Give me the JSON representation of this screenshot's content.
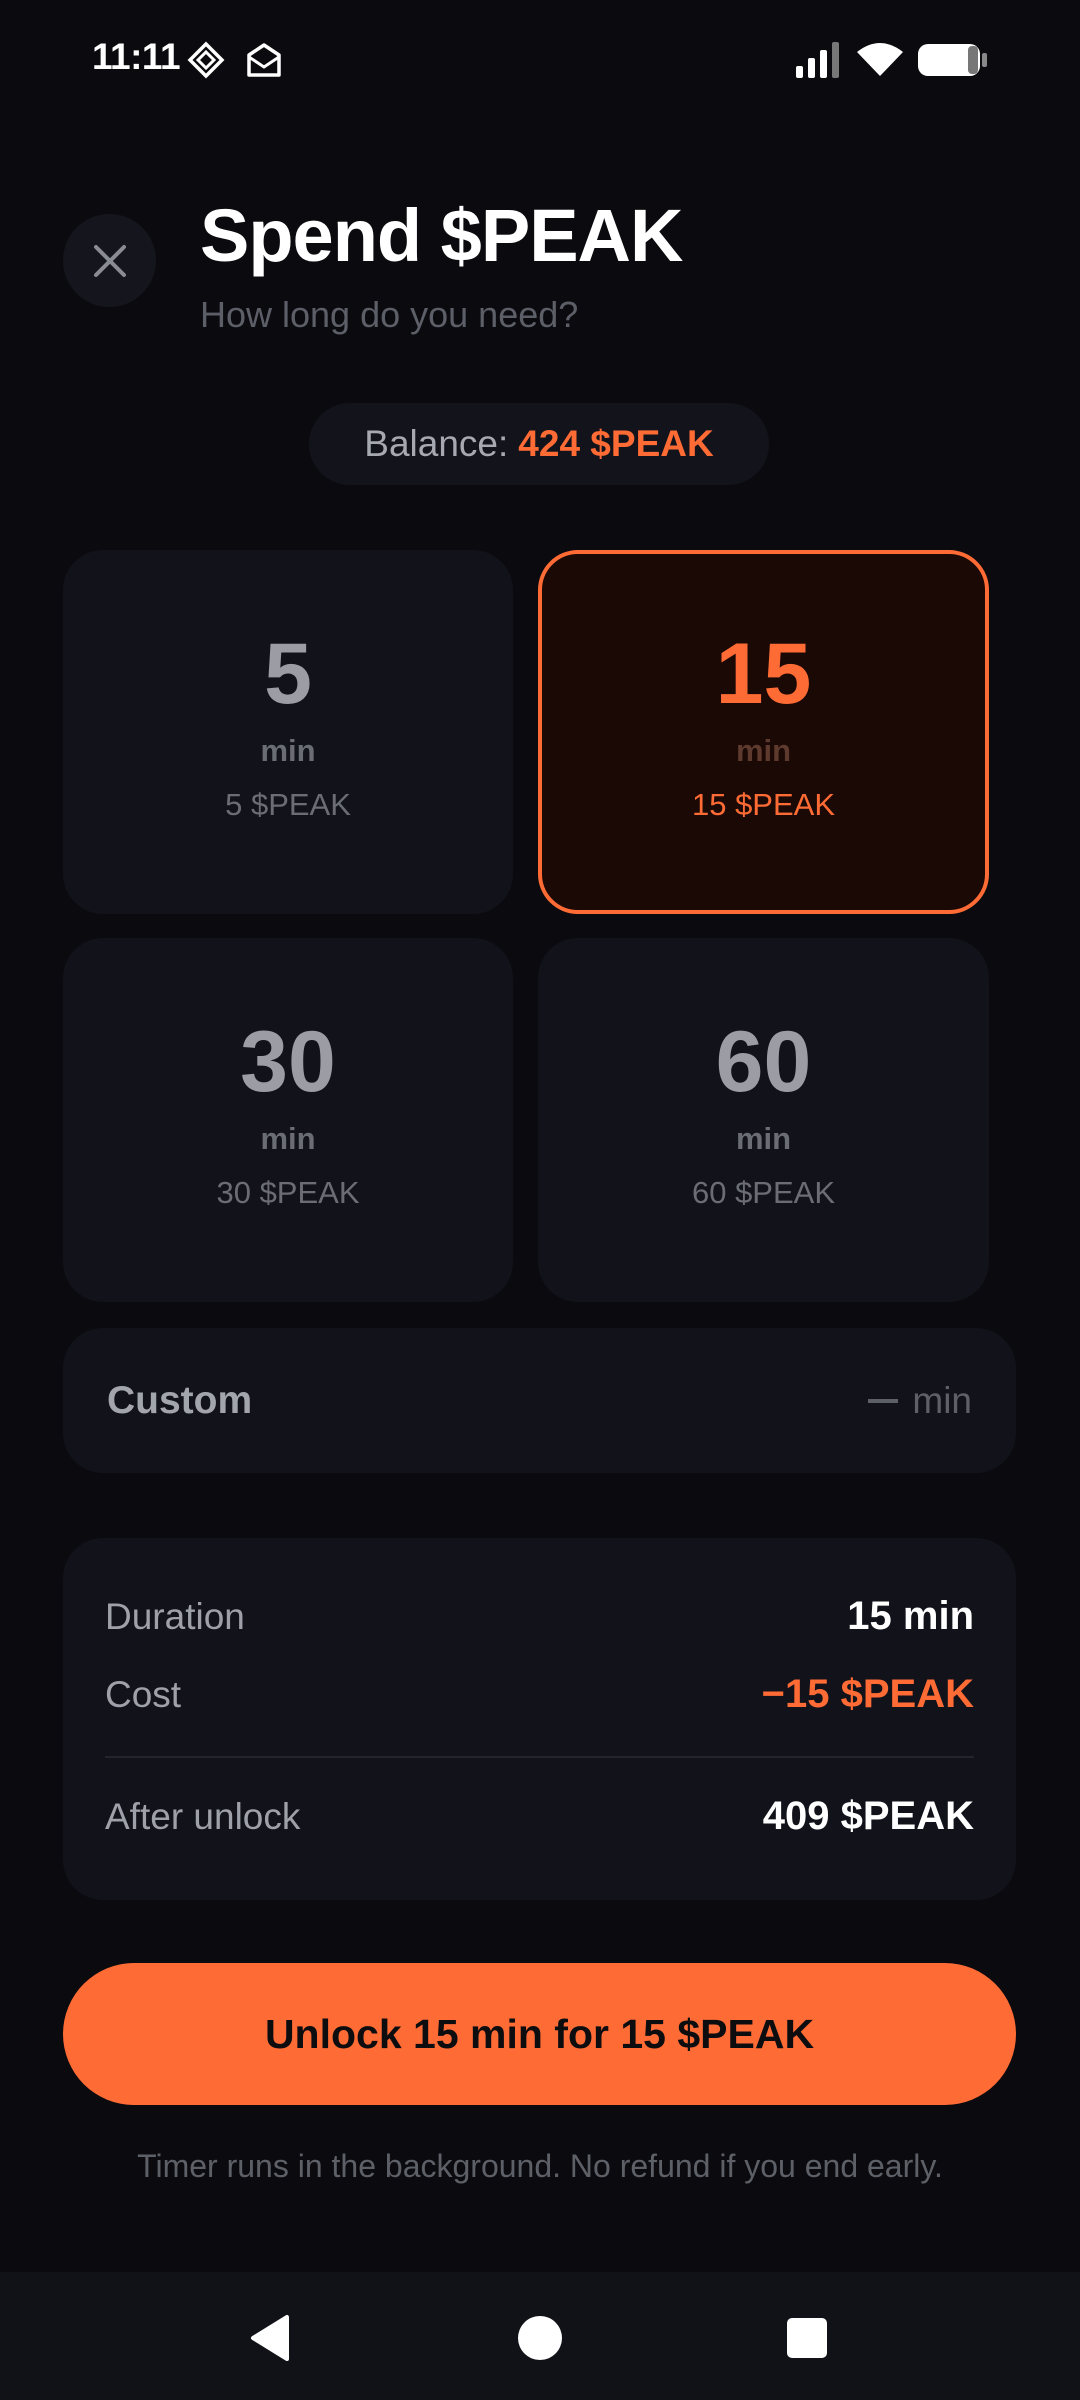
{
  "status_bar": {
    "time": "11:11"
  },
  "header": {
    "title": "Spend $PEAK",
    "subtitle": "How long do you need?"
  },
  "balance": {
    "label": "Balance:",
    "value": "424 $PEAK"
  },
  "options": [
    {
      "minutes": "5",
      "unit": "min",
      "price": "5 $PEAK",
      "selected": false
    },
    {
      "minutes": "15",
      "unit": "min",
      "price": "15 $PEAK",
      "selected": true
    },
    {
      "minutes": "30",
      "unit": "min",
      "price": "30 $PEAK",
      "selected": false
    },
    {
      "minutes": "60",
      "unit": "min",
      "price": "60 $PEAK",
      "selected": false
    }
  ],
  "custom": {
    "label": "Custom",
    "unit": "min"
  },
  "summary": {
    "duration_label": "Duration",
    "duration_value": "15 min",
    "cost_label": "Cost",
    "cost_value": "−15 $PEAK",
    "after_label": "After unlock",
    "after_value": "409 $PEAK"
  },
  "cta": {
    "label": "Unlock 15 min for 15 $PEAK"
  },
  "note": "Timer runs in the background. No refund if you end early.",
  "colors": {
    "accent": "#ff6b35",
    "background": "#0b0b0f",
    "card": "#11121a",
    "selected_card": "#1b0905"
  },
  "icons": {
    "close": "close-icon",
    "back": "back-triangle-icon",
    "home": "home-circle-icon",
    "recents": "recents-square-icon",
    "signal": "signal-icon",
    "wifi": "wifi-icon",
    "battery": "battery-icon"
  }
}
